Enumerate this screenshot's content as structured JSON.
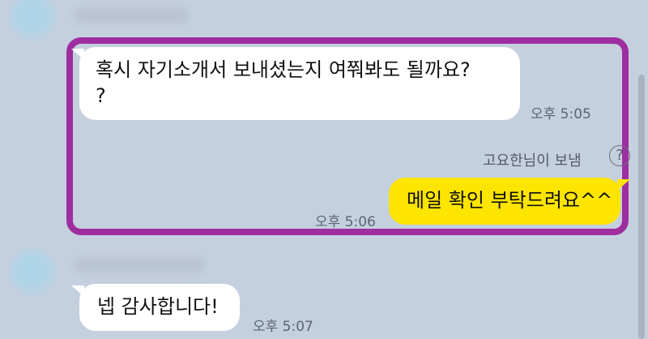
{
  "messages": [
    {
      "id": "m1",
      "side": "left",
      "text_lines": [
        "혹시 자기소개서 보내셨는지 여쭤봐도 될까요?",
        "?"
      ],
      "time": "오후 5:05"
    },
    {
      "id": "m2",
      "side": "right",
      "sent_by": "고요한님이 보냄",
      "text": "메일 확인 부탁드려요^^",
      "time": "오후 5:06"
    },
    {
      "id": "m3",
      "side": "left",
      "text": "넵 감사합니다!",
      "time": "오후 5:07"
    }
  ],
  "icons": {
    "help": "?"
  },
  "colors": {
    "background": "#c5d0df",
    "highlight": "#9e2ea0",
    "own_bubble": "#fee500",
    "other_bubble": "#ffffff"
  }
}
